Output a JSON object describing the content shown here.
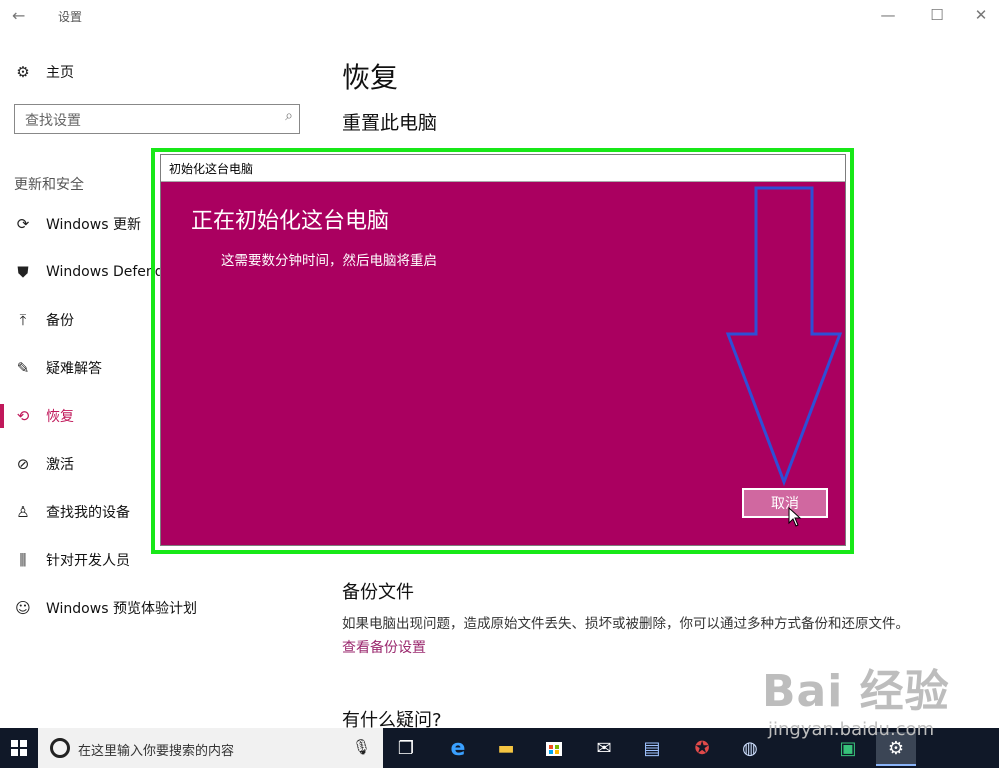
{
  "window": {
    "title": "设置",
    "back_icon": "←",
    "minimize_icon": "—",
    "maximize_icon": "☐",
    "close_icon": "✕"
  },
  "sidebar": {
    "home": {
      "label": "主页",
      "icon": "⚙"
    },
    "search_placeholder": "查找设置",
    "section_title": "更新和安全",
    "items": [
      {
        "label": "Windows 更新",
        "icon": "⟳"
      },
      {
        "label": "Windows Defende",
        "icon": "⛊"
      },
      {
        "label": "备份",
        "icon": "⤒"
      },
      {
        "label": "疑难解答",
        "icon": "✎"
      },
      {
        "label": "恢复",
        "icon": "⟲"
      },
      {
        "label": "激活",
        "icon": "⊘"
      },
      {
        "label": "查找我的设备",
        "icon": "♙"
      },
      {
        "label": "针对开发人员",
        "icon": "⫼"
      },
      {
        "label": "Windows 预览体验计划",
        "icon": "☺"
      }
    ]
  },
  "main": {
    "title": "恢复",
    "subtitle": "重置此电脑",
    "backup": {
      "heading": "备份文件",
      "text": "如果电脑出现问题，造成原始文件丢失、损坏或被删除，你可以通过多种方式备份和还原文件。",
      "link": "查看备份设置"
    },
    "faq_heading": "有什么疑问?"
  },
  "dialog": {
    "title": "初始化这台电脑",
    "heading": "正在初始化这台电脑",
    "message": "这需要数分钟时间，然后电脑将重启",
    "cancel_label": "取消"
  },
  "taskbar": {
    "search_placeholder": "在这里输入你要搜索的内容",
    "icons": [
      "task-view",
      "edge",
      "file-explorer",
      "store",
      "mail",
      "app-1",
      "app-2",
      "app-3",
      "app-4",
      "settings"
    ]
  },
  "watermark": {
    "brand": "Bai 经验",
    "url": "jingyan.baidu.com"
  },
  "colors": {
    "accent": "#c0185a",
    "dialog_bg": "#aa0060",
    "highlight": "#18e818",
    "arrow": "#2e4fd6"
  }
}
